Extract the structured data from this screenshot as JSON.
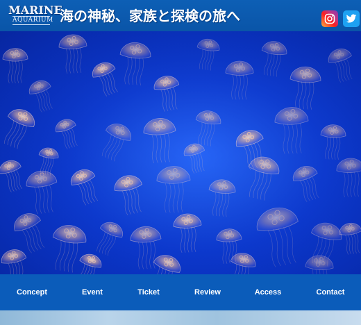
{
  "header": {
    "logo_line1": "MARINE",
    "logo_line2": "AQUARIUM",
    "tagline": "海の神秘、家族と探検の旅へ"
  },
  "social": [
    {
      "name": "instagram-icon",
      "color": "#e1306c"
    },
    {
      "name": "twitter-icon",
      "color": "#1da1f2"
    }
  ],
  "hero": {
    "background": "#0b38d0",
    "subject": "jellyfish"
  },
  "nav": {
    "items": [
      "Concept",
      "Event",
      "Ticket",
      "Review",
      "Access",
      "Contact"
    ]
  },
  "colors": {
    "header": "#0a55a8",
    "nav": "#0b5cba",
    "text": "#ffffff"
  }
}
